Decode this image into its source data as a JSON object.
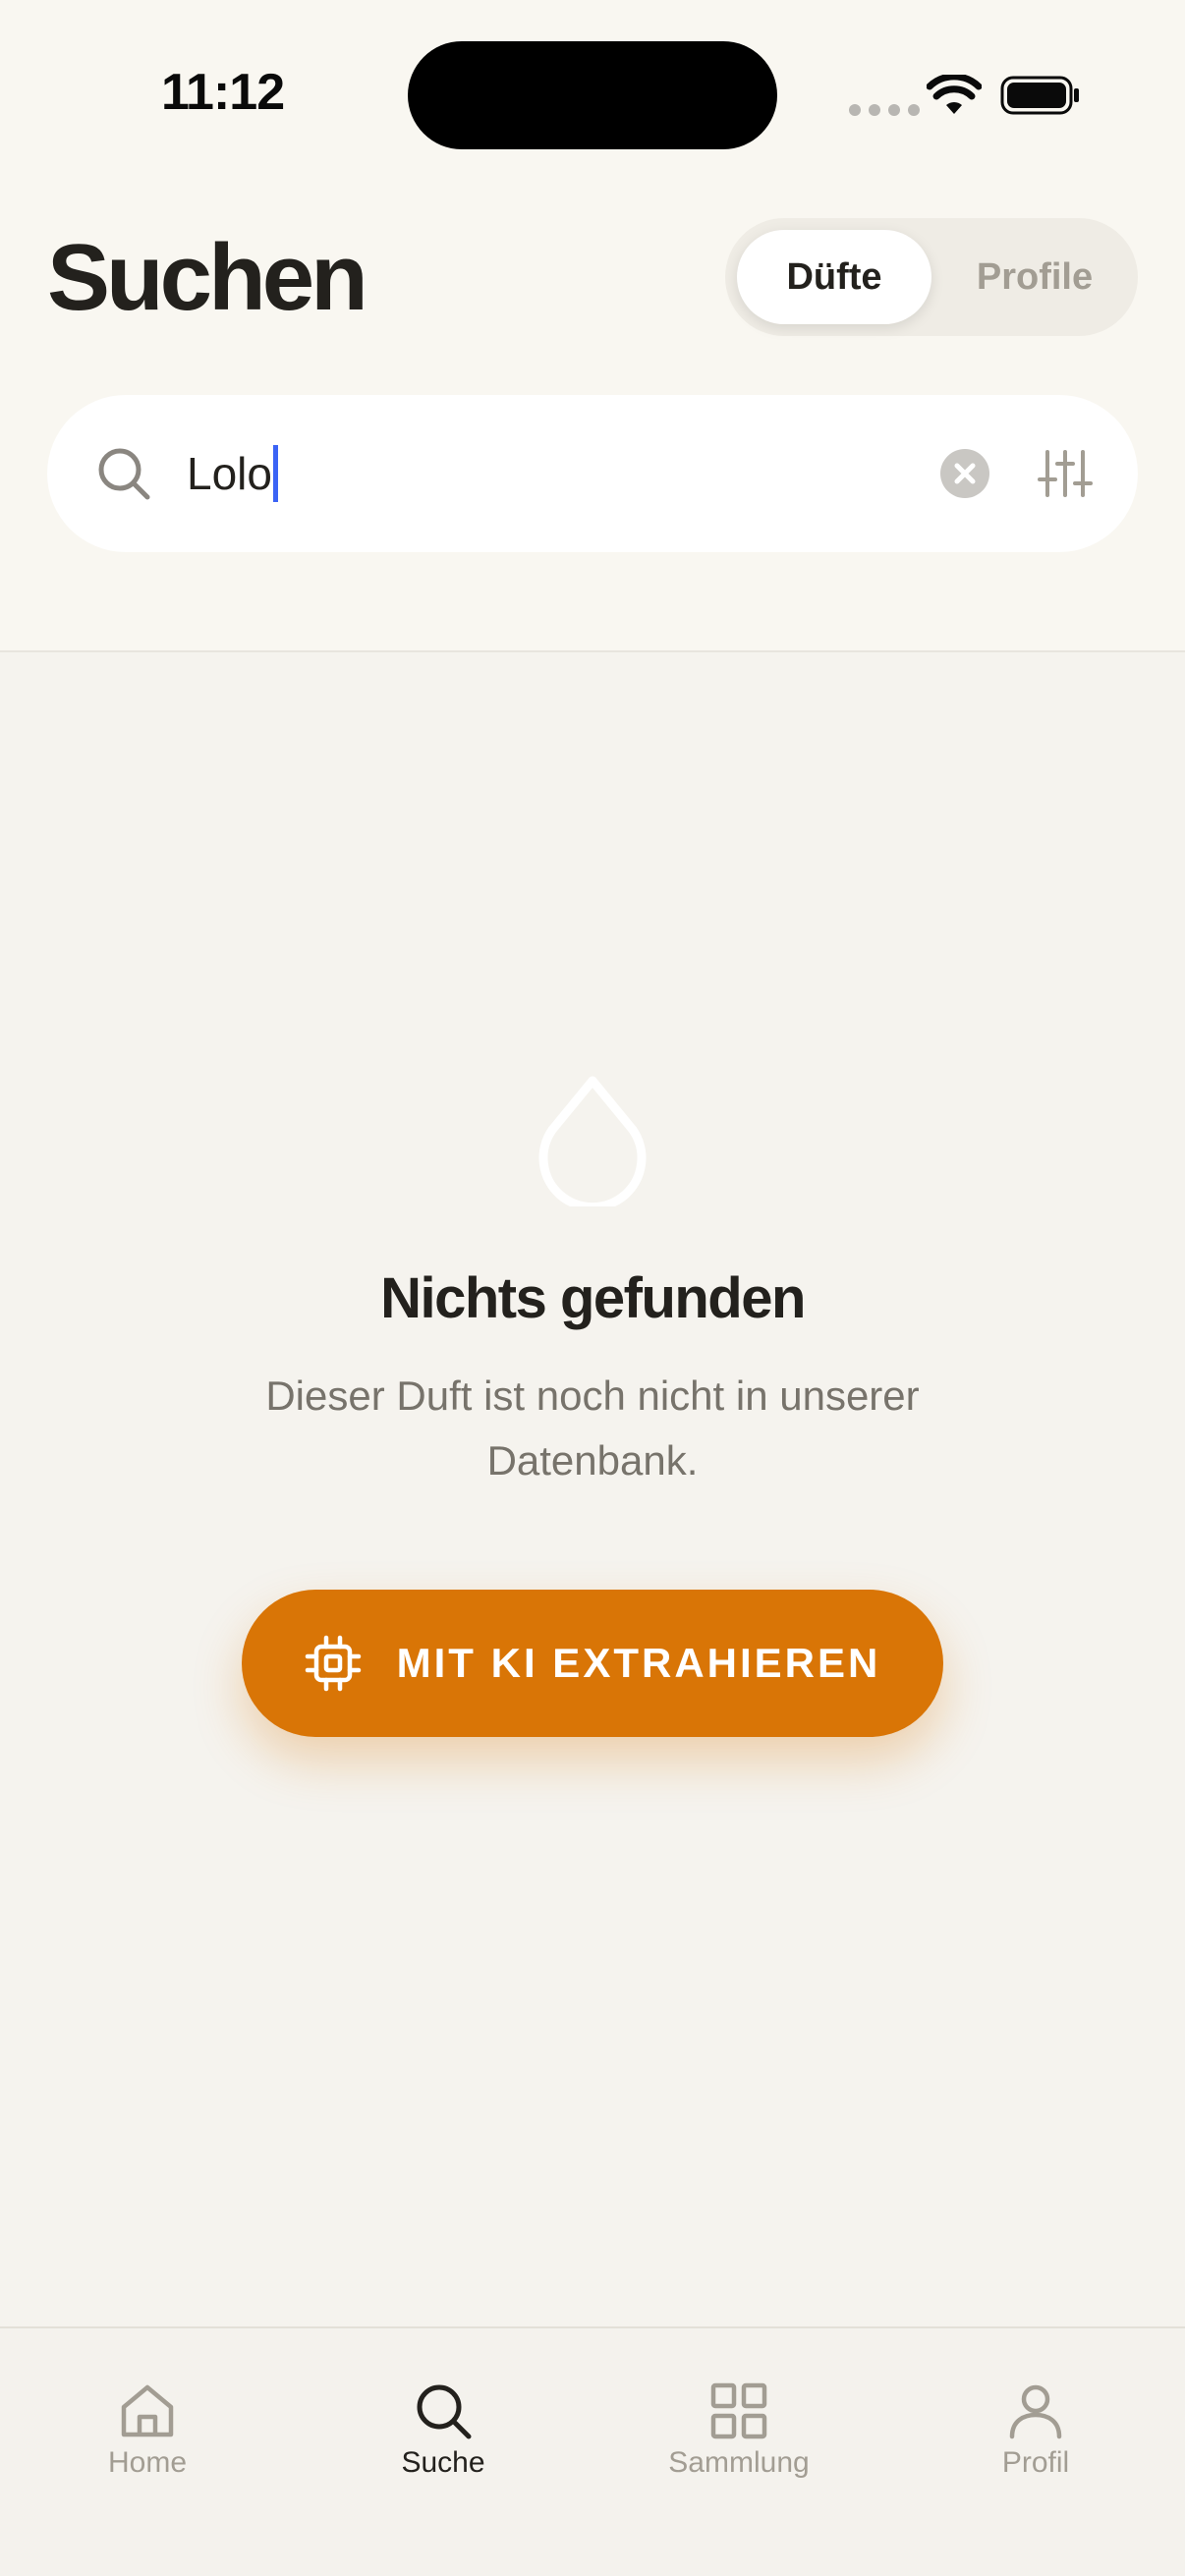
{
  "status_bar": {
    "time": "11:12"
  },
  "header": {
    "title": "Suchen",
    "segments": [
      {
        "label": "Düfte",
        "active": true
      },
      {
        "label": "Profile",
        "active": false
      }
    ]
  },
  "search": {
    "value": "Lolo",
    "icons": [
      "search-icon",
      "clear-icon",
      "filter-sliders-icon"
    ]
  },
  "empty_state": {
    "icon": "drop-icon",
    "title": "Nichts gefunden",
    "description": "Dieser Duft ist noch nicht in unserer Datenbank.",
    "button_label": "MIT KI EXTRAHIEREN",
    "button_icon": "chip-icon"
  },
  "tab_bar": {
    "tabs": [
      {
        "label": "Home",
        "icon": "home-icon",
        "active": false
      },
      {
        "label": "Suche",
        "icon": "search-icon",
        "active": true
      },
      {
        "label": "Sammlung",
        "icon": "grid-icon",
        "active": false
      },
      {
        "label": "Profil",
        "icon": "person-icon",
        "active": false
      }
    ]
  },
  "colors": {
    "accent": "#d97506",
    "background": "#f5f3ee",
    "text": "#23211d",
    "muted": "#a29d93",
    "caret": "#3b63f5"
  }
}
